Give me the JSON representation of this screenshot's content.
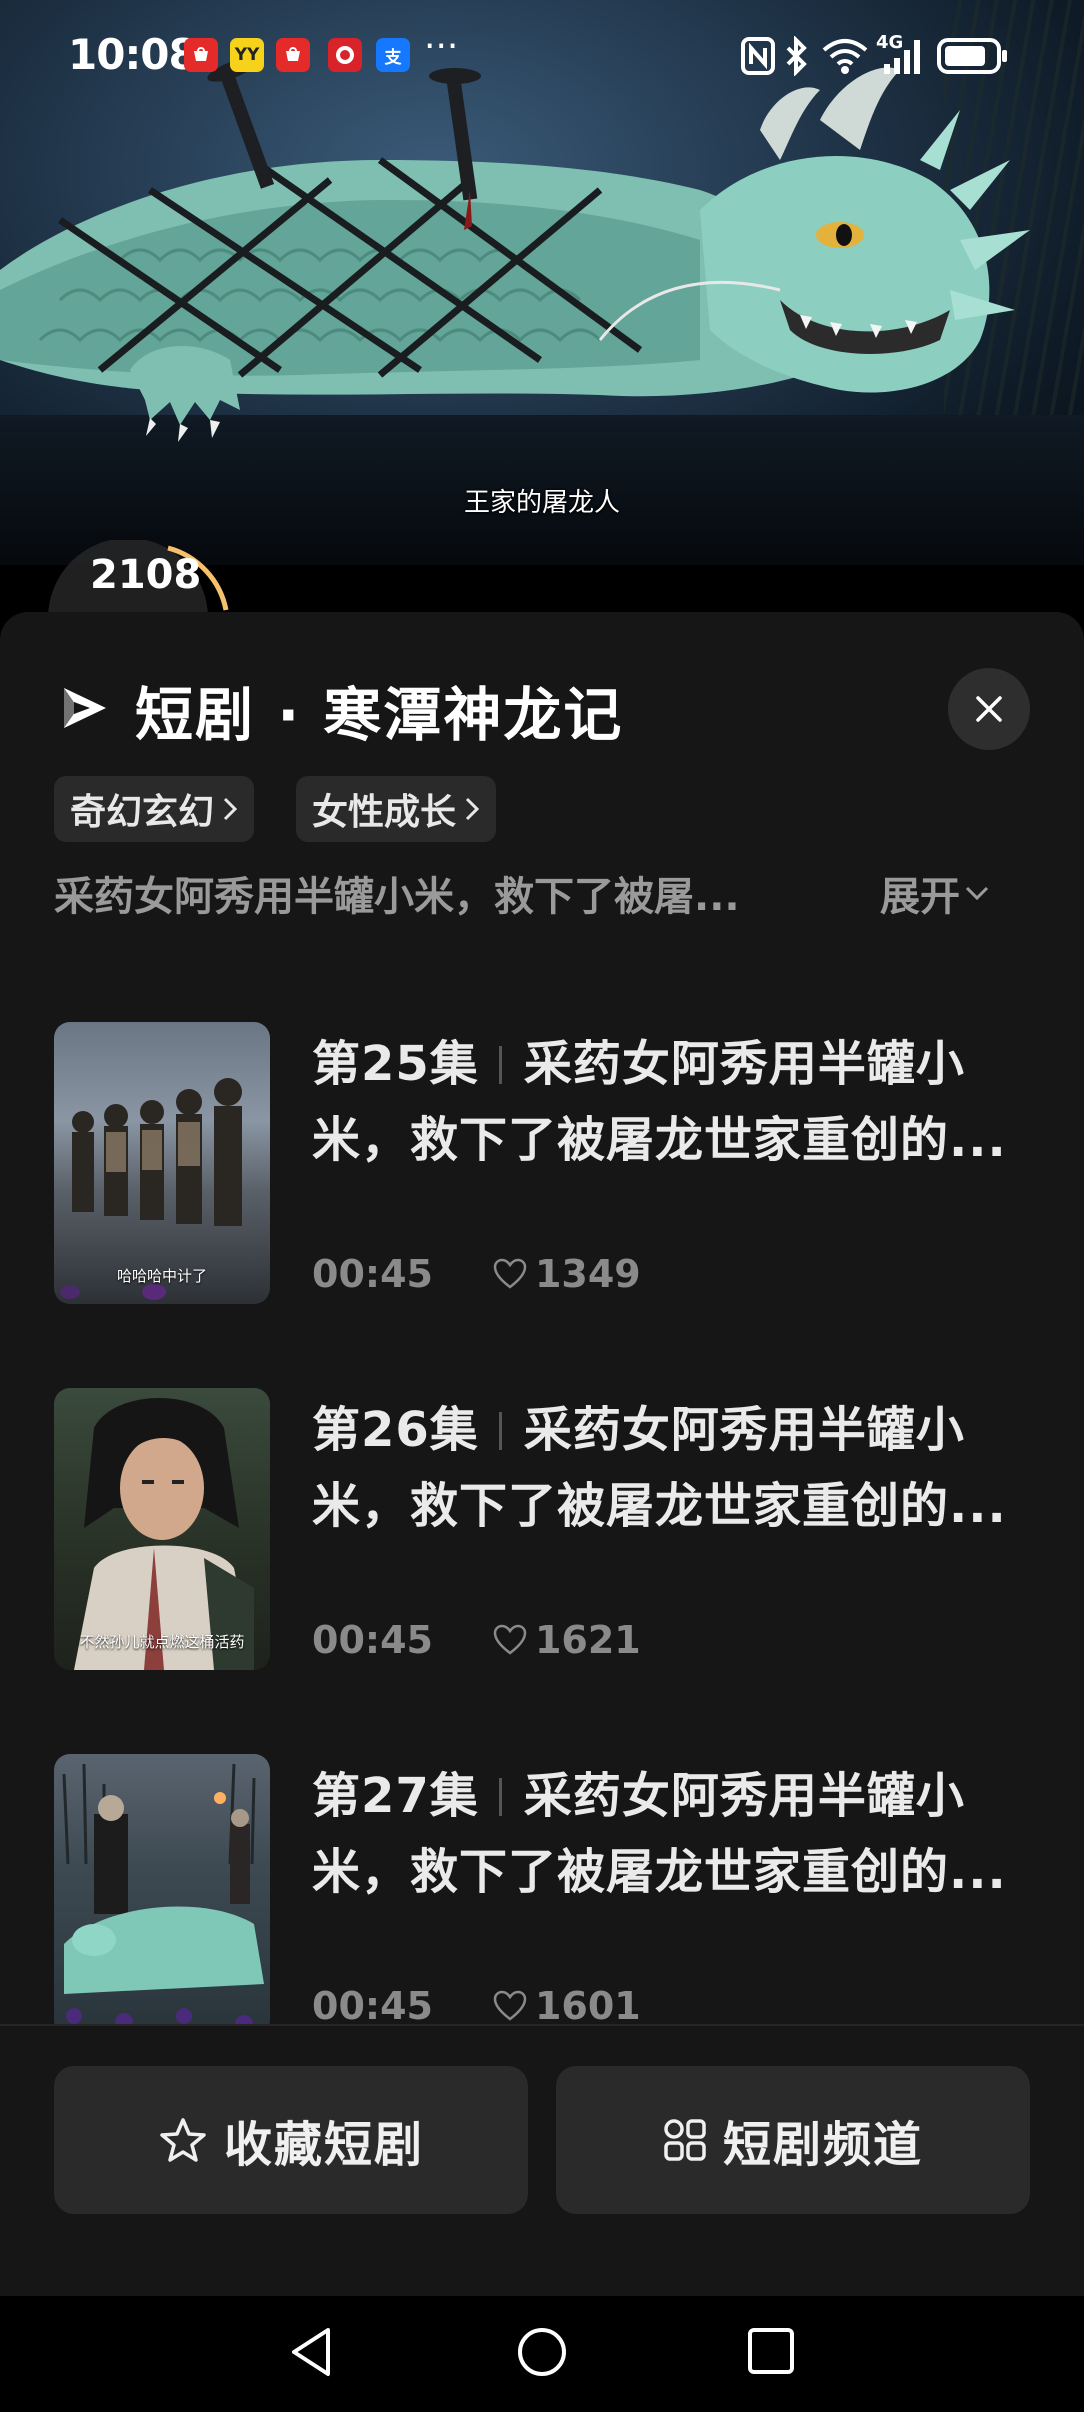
{
  "status_bar": {
    "time": "10:08",
    "app_icons": [
      {
        "name": "huawei-store-icon",
        "label": "HUAWEI",
        "bg": "#e52a2a",
        "fg": "#fff"
      },
      {
        "name": "yy-app-icon",
        "label": "YY",
        "bg": "#f7d21a",
        "fg": "#222"
      },
      {
        "name": "huawei-app-icon",
        "label": "HUAWEI",
        "bg": "#e52a2a",
        "fg": "#fff"
      },
      {
        "name": "red-app-icon",
        "label": "",
        "bg": "#d8232a",
        "fg": "#fff"
      },
      {
        "name": "alipay-icon",
        "label": "支",
        "bg": "#1677ff",
        "fg": "#fff"
      }
    ],
    "more": "···",
    "network": "4G"
  },
  "video": {
    "subtitle": "王家的屠龙人"
  },
  "counter": {
    "value": "2108"
  },
  "sheet": {
    "title": "短剧 · 寒潭神龙记",
    "tags": [
      {
        "label": "奇幻玄幻"
      },
      {
        "label": "女性成长"
      }
    ],
    "synopsis": "采药女阿秀用半罐小米，救下了被屠...",
    "expand_label": "展开",
    "episodes": [
      {
        "number": "第25集",
        "title_line1": "采药女阿秀用半罐小",
        "title_line2": "米，救下了被屠龙世家重创的...",
        "duration": "00:45",
        "likes": "1349",
        "thumb_caption": "哈哈哈中计了"
      },
      {
        "number": "第26集",
        "title_line1": "采药女阿秀用半罐小",
        "title_line2": "米，救下了被屠龙世家重创的...",
        "duration": "00:45",
        "likes": "1621",
        "thumb_caption": "不然孙儿就点燃这桶活药"
      },
      {
        "number": "第27集",
        "title_line1": "采药女阿秀用半罐小",
        "title_line2": "米，救下了被屠龙世家重创的...",
        "duration": "00:45",
        "likes": "1601",
        "thumb_caption": ""
      }
    ],
    "actions": {
      "favorite_label": "收藏短剧",
      "channel_label": "短剧频道"
    }
  },
  "colors": {
    "sheet_bg": "#161616",
    "button_bg": "#2a2a2a",
    "muted_text": "#9a9a9a",
    "accent_ring": "#f5c26b"
  }
}
